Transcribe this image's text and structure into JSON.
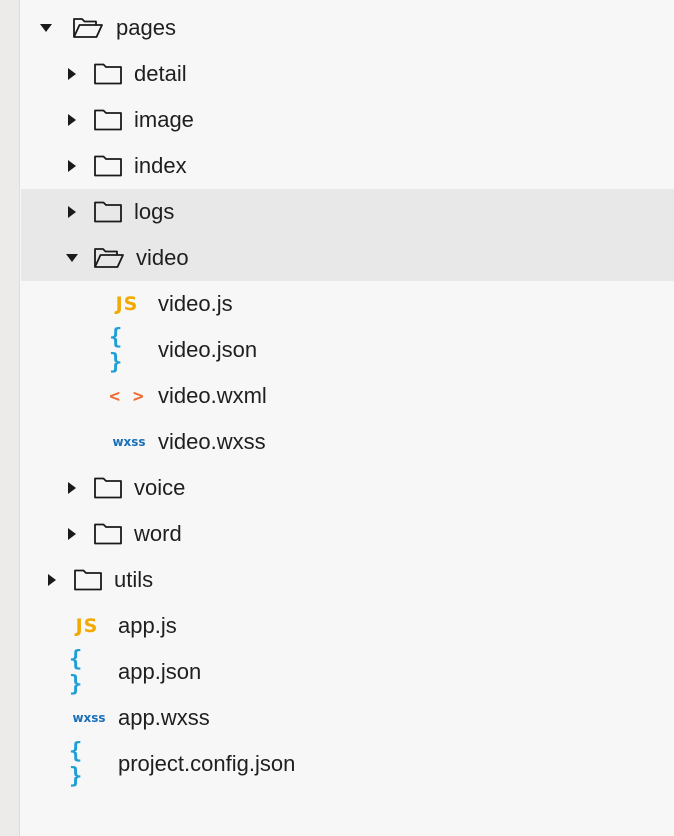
{
  "tree": {
    "pages": {
      "label": "pages",
      "expanded": true
    },
    "pages_children": {
      "detail": {
        "label": "detail",
        "expanded": false
      },
      "image": {
        "label": "image",
        "expanded": false
      },
      "index": {
        "label": "index",
        "expanded": false
      },
      "logs": {
        "label": "logs",
        "expanded": false
      },
      "video": {
        "label": "video",
        "expanded": true
      },
      "voice": {
        "label": "voice",
        "expanded": false
      },
      "word": {
        "label": "word",
        "expanded": false
      }
    },
    "video_files": {
      "js": {
        "label": "video.js",
        "badge": "JS"
      },
      "json": {
        "label": "video.json",
        "badge": "{ }"
      },
      "wxml": {
        "label": "video.wxml",
        "badge": "< >"
      },
      "wxss": {
        "label": "video.wxss",
        "badge": "wxss"
      }
    },
    "utils": {
      "label": "utils",
      "expanded": false
    },
    "root_files": {
      "app_js": {
        "label": "app.js",
        "badge": "JS"
      },
      "app_json": {
        "label": "app.json",
        "badge": "{ }"
      },
      "app_wxss": {
        "label": "app.wxss",
        "badge": "wxss"
      },
      "project_config": {
        "label": "project.config.json",
        "badge": "{ }"
      }
    }
  },
  "colors": {
    "js": "#f2a900",
    "json": "#1e9fd6",
    "wxml": "#ef6a2f",
    "wxss": "#1a6fb8",
    "selected_row": "#e8e8e8",
    "background": "#f7f7f7"
  }
}
